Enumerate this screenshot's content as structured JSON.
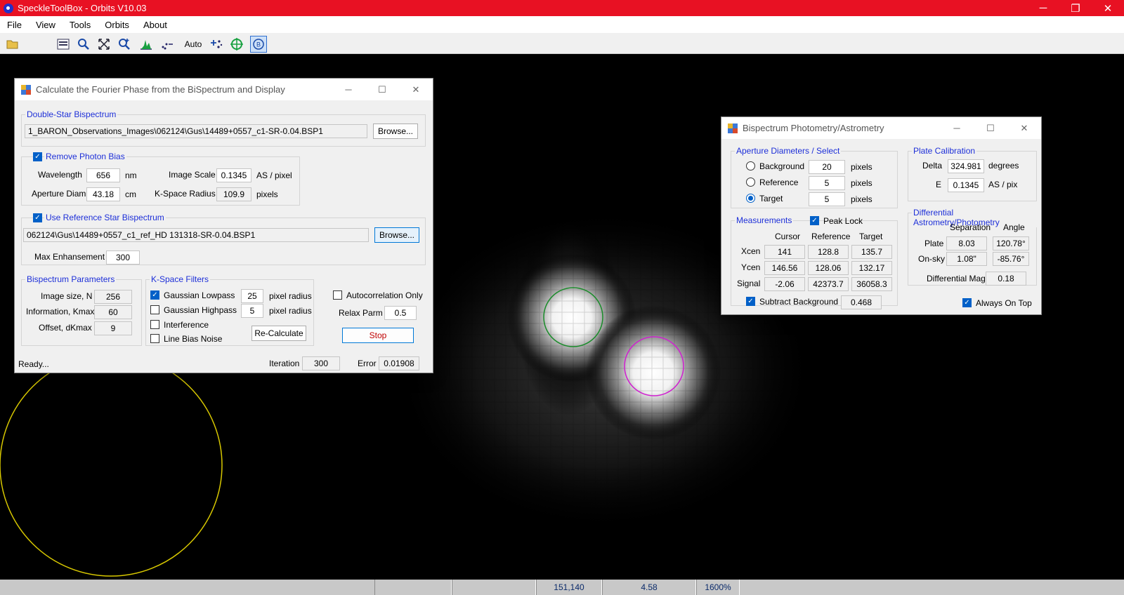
{
  "app": {
    "title": "SpeckleToolBox - Orbits V10.03",
    "window_controls": {
      "minimize": "─",
      "restore": "❐",
      "close": "✕"
    }
  },
  "menu": {
    "items": [
      "File",
      "View",
      "Tools",
      "Orbits",
      "About"
    ]
  },
  "toolbar": {
    "auto_label": "Auto"
  },
  "status_bar": {
    "cells": [
      "",
      "",
      "151,140",
      "4.58",
      "1600%"
    ]
  },
  "fourier_window": {
    "title": "Calculate the Fourier Phase from the BiSpectrum and Display",
    "double_star": {
      "group_label": "Double-Star Bispectrum",
      "path": "1_BARON_Observations_Images\\062124\\Gus\\14489+0557_c1-SR-0.04.BSP1",
      "browse": "Browse..."
    },
    "photon_bias": {
      "label": "Remove Photon Bias",
      "checked": true,
      "wavelength_label": "Wavelength",
      "wavelength": "656",
      "wavelength_unit": "nm",
      "image_scale_label": "Image Scale",
      "image_scale": "0.1345",
      "image_scale_unit": "AS / pixel",
      "aperture_label": "Aperture Diam",
      "aperture": "43.18",
      "aperture_unit": "cm",
      "kspace_label": "K-Space Radius",
      "kspace": "109.9",
      "kspace_unit": "pixels"
    },
    "reference": {
      "label": "Use Reference Star Bispectrum",
      "checked": true,
      "path": "062124\\Gus\\14489+0557_c1_ref_HD 131318-SR-0.04.BSP1",
      "browse": "Browse...",
      "max_enh_label": "Max Enhansement",
      "max_enh": "300"
    },
    "params": {
      "group_label": "Bispectrum Parameters",
      "size_label": "Image size, N",
      "size": "256",
      "info_label": "Information, Kmax",
      "info": "60",
      "offset_label": "Offset, dKmax",
      "offset": "9"
    },
    "filters": {
      "group_label": "K-Space Filters",
      "lowpass_label": "Gaussian Lowpass",
      "lowpass_checked": true,
      "lowpass": "25",
      "lowpass_unit": "pixel radius",
      "highpass_label": "Gaussian Highpass",
      "highpass_checked": false,
      "highpass": "5",
      "highpass_unit": "pixel radius",
      "interference_label": "Interference",
      "linebias_label": "Line Bias Noise",
      "recalc": "Re-Calculate"
    },
    "autocorr_label": "Autocorrelation Only",
    "relax_label": "Relax Parm",
    "relax": "0.5",
    "stop": "Stop",
    "status": "Ready...",
    "iteration_label": "Iteration",
    "iteration": "300",
    "error_label": "Error",
    "error": "0.01908"
  },
  "photometry_window": {
    "title": "Bispectrum Photometry/Astrometry",
    "aperture": {
      "group_label": "Aperture Diameters / Select",
      "background_label": "Background",
      "background": "20",
      "reference_label": "Reference",
      "reference": "5",
      "target_label": "Target",
      "target": "5",
      "unit": "pixels",
      "selected": "target"
    },
    "plate_cal": {
      "group_label": "Plate Calibration",
      "delta_label": "Delta",
      "delta": "324.981",
      "delta_unit": "degrees",
      "e_label": "E",
      "e": "0.1345",
      "e_unit": "AS / pix"
    },
    "measurements": {
      "group_label": "Measurements",
      "peak_lock_label": "Peak Lock",
      "peak_lock": true,
      "columns": [
        "Cursor",
        "Reference",
        "Target"
      ],
      "rows": [
        {
          "label": "Xcen",
          "values": [
            "141",
            "128.8",
            "135.7"
          ]
        },
        {
          "label": "Ycen",
          "values": [
            "146.56",
            "128.06",
            "132.17"
          ]
        },
        {
          "label": "Signal",
          "values": [
            "-2.06",
            "42373.7",
            "36058.3"
          ]
        }
      ],
      "subtract_label": "Subtract Background",
      "subtract_checked": true,
      "subtract": "0.468"
    },
    "differential": {
      "group_label": "Differential Astrometry/Photometry",
      "sep_header": "Separation",
      "angle_header": "Angle",
      "plate_label": "Plate",
      "plate_sep": "8.03",
      "plate_angle": "120.78°",
      "onsky_label": "On-sky",
      "onsky_sep": "1.08\"",
      "onsky_angle": "-85.76°",
      "dmag_label": "Differential Mag",
      "dmag": "0.18"
    },
    "always_on_top_label": "Always On Top",
    "always_on_top": true
  }
}
